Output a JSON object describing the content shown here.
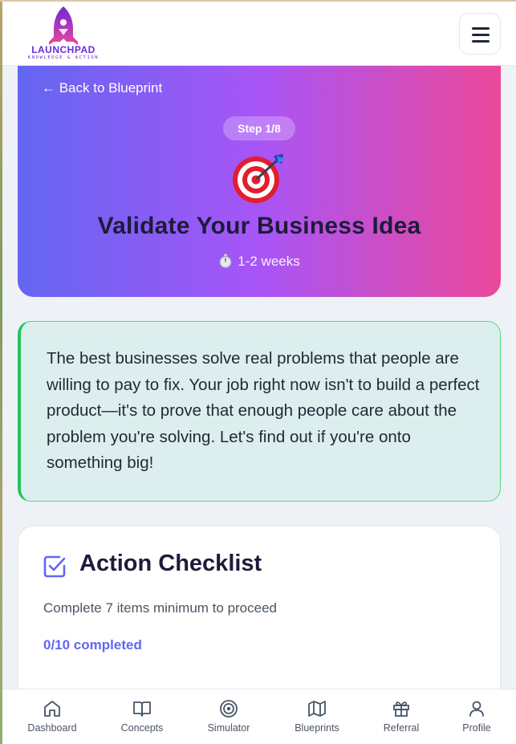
{
  "header": {
    "logo_name": "LAUNCHPAD",
    "logo_tagline": "KNOWLEDGE & ACTION",
    "menu_icon": "hamburger-menu-icon"
  },
  "hero": {
    "back_label": "← Back to Blueprint",
    "step_badge": "Step 1/8",
    "emoji_icon": "target-dart-icon",
    "title": "Validate Your Business Idea",
    "duration": "1-2 weeks",
    "gradient": [
      "#6366f1",
      "#a855f7",
      "#ec4899"
    ]
  },
  "intro": {
    "text": "The best businesses solve real problems that people are willing to pay to fix. Your job right now isn't to build a perfect product—it's to prove that enough people care about the problem you're solving. Let's find out if you're onto something big!",
    "accent": "#22c55e"
  },
  "checklist": {
    "title": "Action Checklist",
    "subtitle": "Complete 7 items minimum to proceed",
    "progress": "0/10 completed",
    "accent": "#6366f1"
  },
  "nav": [
    {
      "label": "Dashboard",
      "icon": "home-icon"
    },
    {
      "label": "Concepts",
      "icon": "book-icon"
    },
    {
      "label": "Simulator",
      "icon": "target-icon"
    },
    {
      "label": "Blueprints",
      "icon": "map-icon"
    },
    {
      "label": "Referral",
      "icon": "gift-icon"
    },
    {
      "label": "Profile",
      "icon": "user-icon"
    }
  ]
}
